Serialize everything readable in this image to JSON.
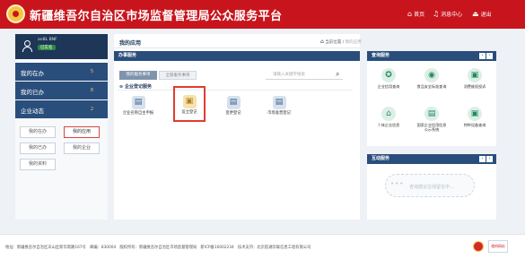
{
  "header": {
    "site_title": "新疆维吾尔自治区市场监督管理局公众服务平台",
    "nav": {
      "home": "首页",
      "messages": "消息中心",
      "logout": "退出"
    }
  },
  "sidebar": {
    "username": "anBL BNF",
    "role": "已实名",
    "stats": [
      {
        "label": "我的在办",
        "count": "5"
      },
      {
        "label": "我的已办",
        "count": "8"
      },
      {
        "label": "企业动态",
        "count": "2"
      }
    ],
    "buttons": [
      "我的在办",
      "我的应用",
      "我的已办",
      "我的企业",
      "我的资料"
    ]
  },
  "main": {
    "title": "我的应用",
    "breadcrumb": {
      "home": "当前位置",
      "current": "我的应用"
    },
    "section_title": "办事服务",
    "tabs": [
      "我的服务事项",
      "全部服务事项"
    ],
    "search_placeholder": "请输入关键字搜索",
    "group_title": "企业登记服务",
    "services": [
      {
        "label": "企业名称自主申报",
        "icon": "name-declaration-icon",
        "glyph": "▤"
      },
      {
        "label": "设立登记",
        "icon": "establishment-icon",
        "glyph": "▣"
      },
      {
        "label": "变更登记",
        "icon": "change-registration-icon",
        "glyph": "▤"
      },
      {
        "label": "市场准营登记",
        "icon": "market-license-icon",
        "glyph": "▤"
      }
    ]
  },
  "query_panel": {
    "title": "查询服务",
    "items": [
      {
        "label": "企业信用查询",
        "glyph": "✪",
        "icon": "credit-query-icon"
      },
      {
        "label": "食品安全标准查询",
        "glyph": "◉",
        "icon": "food-safety-icon"
      },
      {
        "label": "消费维权投诉",
        "glyph": "▣",
        "icon": "consumer-complaint-icon"
      },
      {
        "label": "个体企业信息",
        "glyph": "⌂",
        "icon": "individual-business-icon"
      },
      {
        "label": "国家企业信用信息公示系统",
        "glyph": "▤",
        "icon": "national-credit-icon"
      },
      {
        "label": "特种设备查询",
        "glyph": "▣",
        "icon": "special-equipment-icon"
      }
    ]
  },
  "interact_panel": {
    "title": "互动服务",
    "placeholder": "咨询建议在线留言中..."
  },
  "footer": {
    "address": "地址：新疆维吾尔自治区天山区新华南路167号",
    "postcode": "邮编：830004",
    "copyright": "版权所有：新疆维吾尔自治区市场监督管理局",
    "icp": "新ICP备10002234",
    "support": "技术支持：北京航通华联信息工程有限公司",
    "badge_text": "政府网站"
  },
  "colors": {
    "brand_red": "#c8151d",
    "navy": "#2a4e7c",
    "dark_navy": "#1e3658",
    "selected_border": "#e03c31"
  }
}
